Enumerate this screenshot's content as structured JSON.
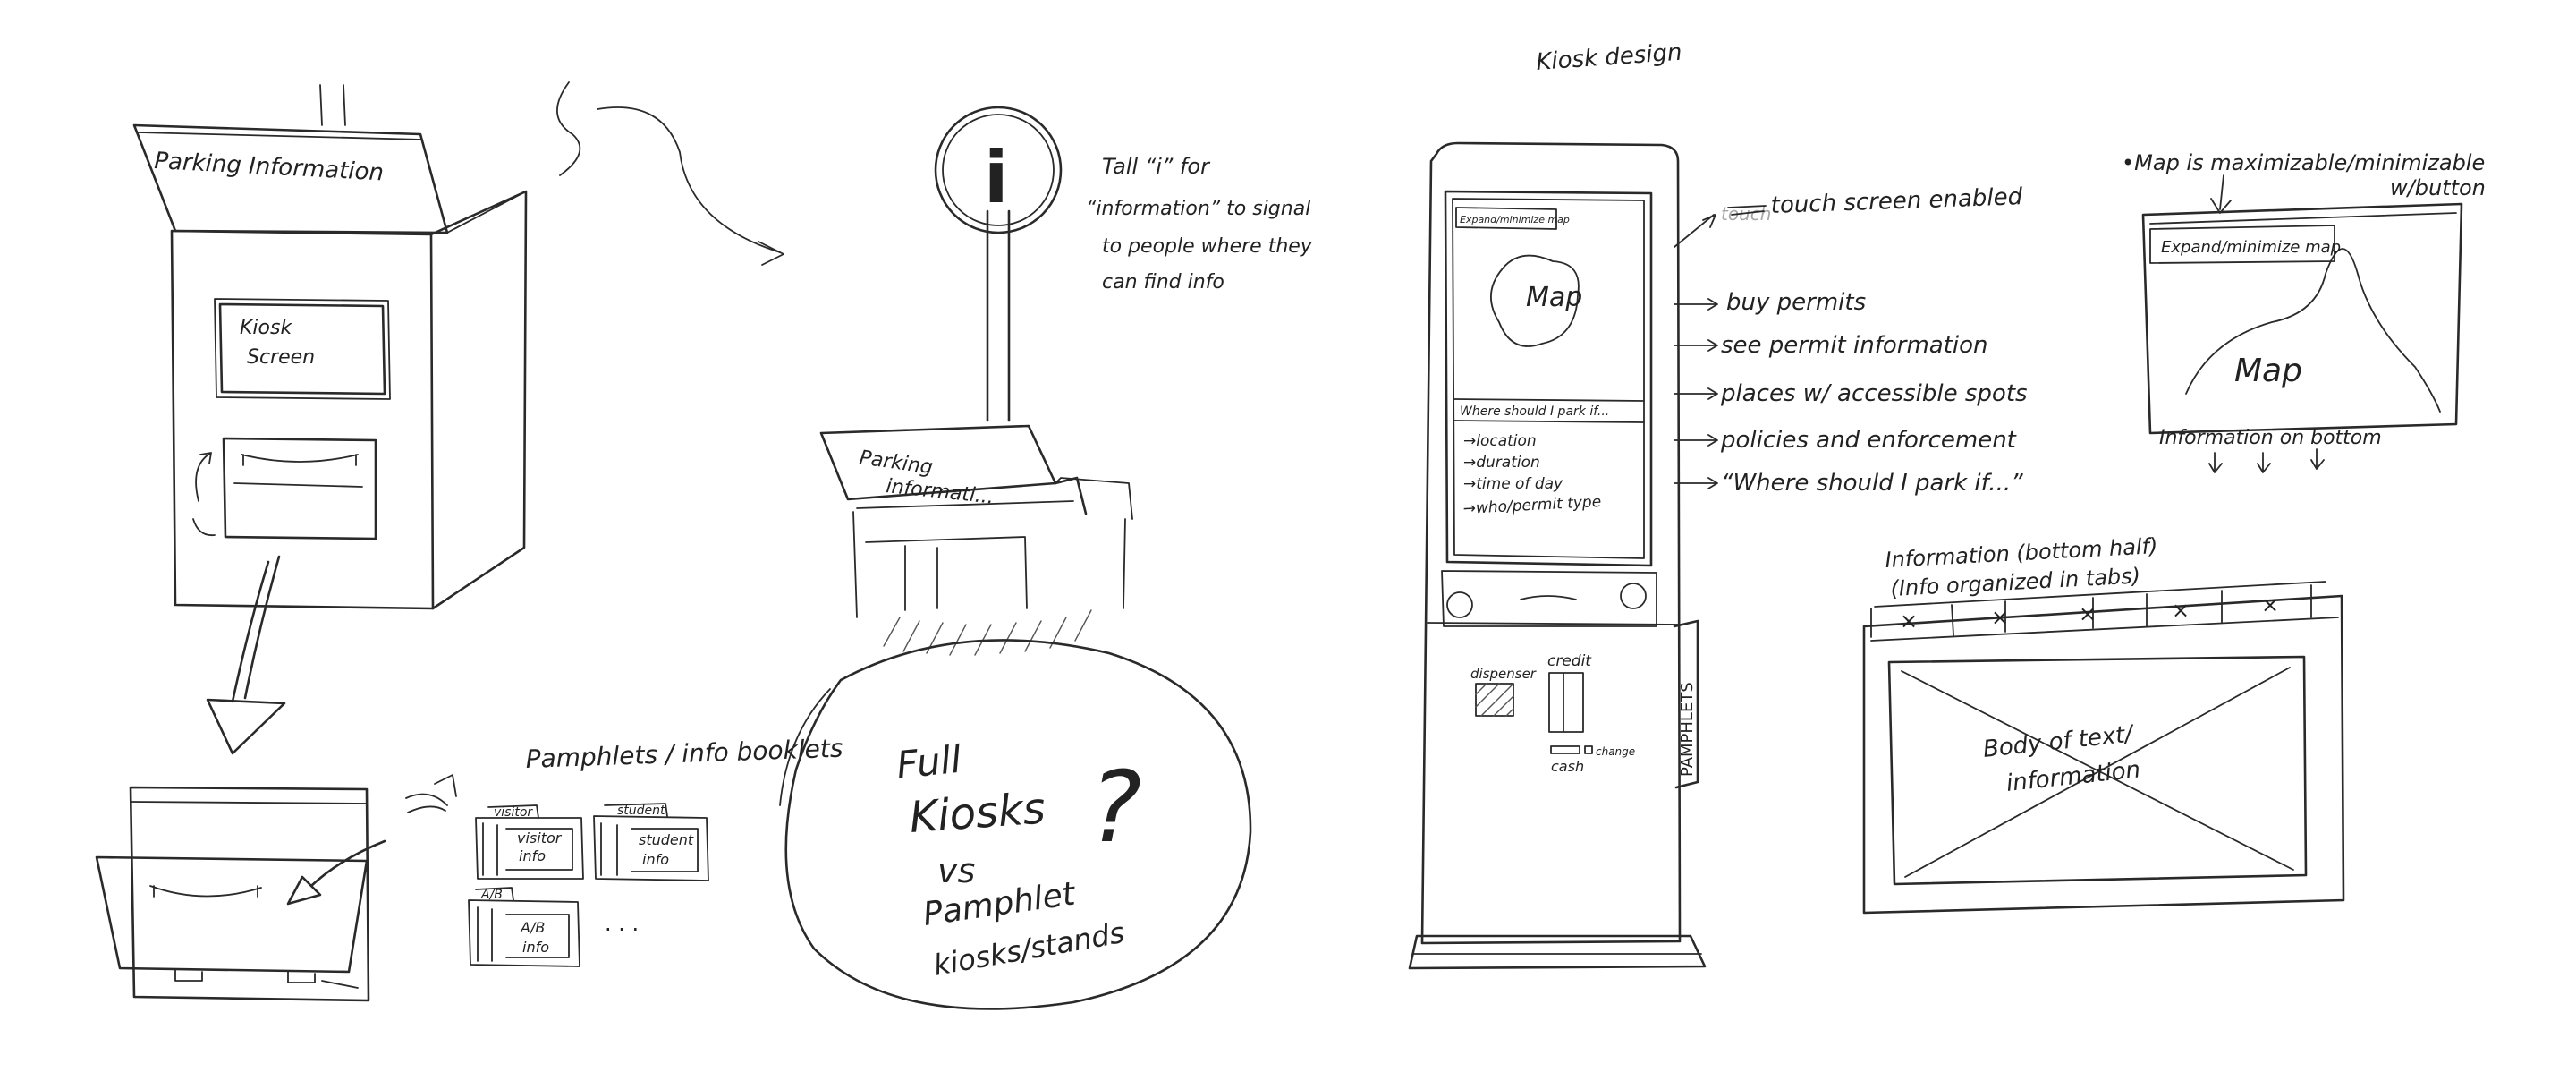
{
  "page_title": "Kiosk design",
  "sketch_1": {
    "box_label": "Parking Information",
    "screen_label_line1": "Kiosk",
    "screen_label_line2": "Screen"
  },
  "pamphlets": {
    "heading": "Pamphlets / info booklets",
    "folders": [
      {
        "tab": "visitor",
        "body_line1": "visitor",
        "body_line2": "info"
      },
      {
        "tab": "student",
        "body_line1": "student",
        "body_line2": "info"
      },
      {
        "tab": "A/B",
        "body_line1": "A/B",
        "body_line2": "info"
      }
    ],
    "ellipsis": ". . ."
  },
  "sign_kiosk": {
    "sign_glyph": "i",
    "note_lines": [
      "Tall “i” for",
      "“information” to signal",
      "to people where they",
      "can find info"
    ],
    "stand_label_line1": "Parking",
    "stand_label_line2": "informati..."
  },
  "question_bubble": {
    "lines": [
      "Full",
      "Kiosks",
      "vs",
      "Pamphlet",
      "kiosks/stands"
    ],
    "mark": "?"
  },
  "kiosk_design": {
    "screen_button": "Expand/minimize map",
    "map_label": "Map",
    "section_title": "Where should I park if...",
    "list_items": [
      "→location",
      "→duration",
      "→time of day",
      "→who/permit type"
    ],
    "dispenser_label": "dispenser",
    "credit_label": "credit",
    "cash_label": "cash",
    "change_label": "change",
    "side_label": "PAMPHLETS"
  },
  "features": {
    "struck_word": "touch",
    "items": [
      "touch screen enabled",
      "buy permits",
      "see permit information",
      "places w/ accessible spots",
      "policies and enforcement",
      "“Where should I park if...”"
    ]
  },
  "map_note": {
    "note_line1": "•Map is maximizable/minimizable",
    "note_line2": "w/button",
    "button_label": "Expand/minimize map",
    "map_label": "Map",
    "caption": "Information on bottom"
  },
  "tabs_note": {
    "title_line1": "Information (bottom half)",
    "title_line2": "(Info organized in tabs)",
    "tab_marks": [
      "×",
      "×",
      "×",
      "×",
      "×"
    ],
    "body_line1": "Body of text/",
    "body_line2": "information"
  }
}
